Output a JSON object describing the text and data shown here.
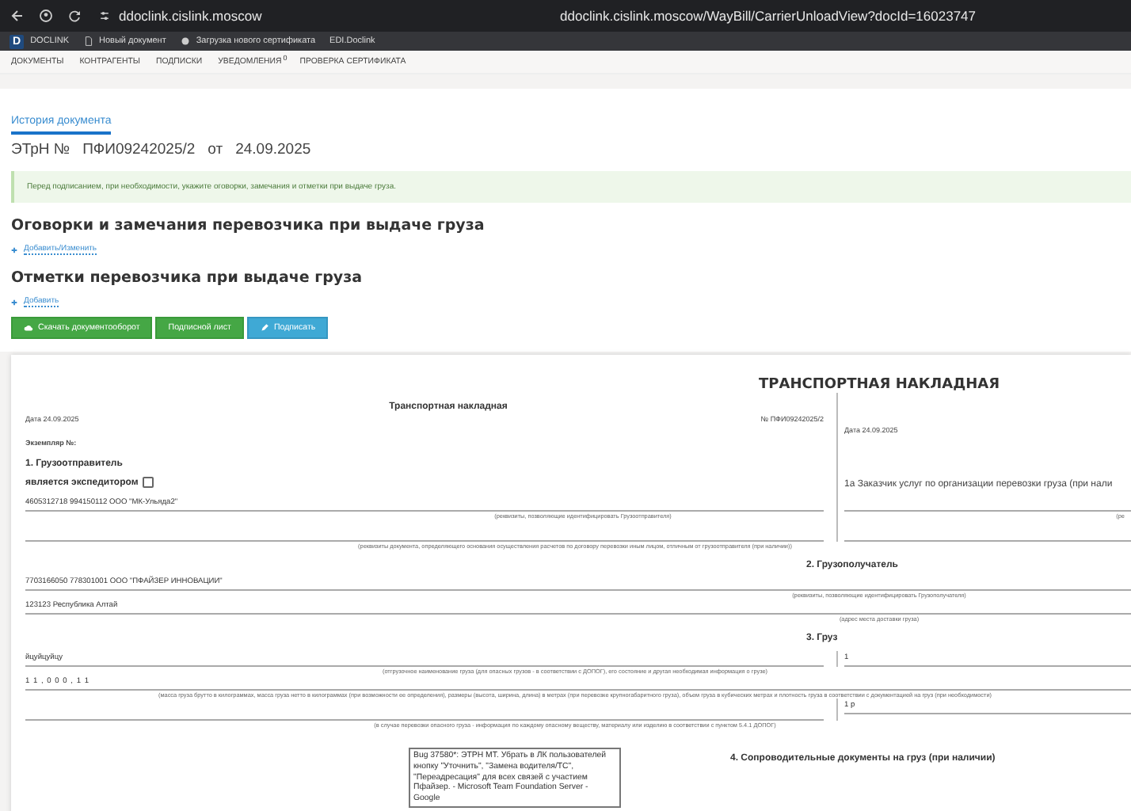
{
  "browser": {
    "address": "ddoclink.cislink.moscow",
    "page_title": "ddoclink.cislink.moscow/WayBill/CarrierUnloadView?docId=16023747"
  },
  "bookmarks": {
    "logo_letter": "D",
    "logo_text": "DOCLINK",
    "items": [
      {
        "kind": "doc",
        "label": "Новый документ"
      },
      {
        "kind": "dot",
        "label": "Загрузка нового сертификата"
      },
      {
        "kind": "plain",
        "label": "EDI.Doclink"
      }
    ]
  },
  "nav": [
    {
      "label": "ДОКУМЕНТЫ"
    },
    {
      "label": "КОНТРАГЕНТЫ"
    },
    {
      "label": "ПОДПИСКИ"
    },
    {
      "label": "УВЕДОМЛЕНИЯ",
      "badge": "0"
    },
    {
      "label": "ПРОВЕРКА СЕРТИФИКАТА"
    }
  ],
  "tabs": [
    {
      "label": "История документа",
      "selected": true
    }
  ],
  "doc_heading": {
    "type": "ЭТрН №",
    "number": "ПФИ09242025/2",
    "from": "от",
    "date": "24.09.2025"
  },
  "alert": "Перед подписанием, при необходимости, укажите оговорки, замечания и отметки при выдаче груза.",
  "sections": [
    {
      "title": "Оговорки и замечания перевозчика при выдаче груза",
      "link": "Добавить/Изменить"
    },
    {
      "title": "Отметки перевозчика при выдаче груза",
      "link": "Добавить"
    }
  ],
  "buttons": [
    {
      "kind": "download",
      "label": "Скачать документооборот"
    },
    {
      "kind": "plain",
      "label": "Подписной лист"
    },
    {
      "kind": "sign",
      "label": "Подписать"
    }
  ],
  "waybill": {
    "title": "ТРАНСПОРТНАЯ НАКЛАДНАЯ",
    "subtitle": "Транспортная накладная",
    "date_left": "Дата 24.09.2025",
    "number": "№  ПФИ09242025/2",
    "date_right": "Дата 24.09.2025",
    "copy": "Экземпляр №:",
    "shipper_title": "1. Грузоотправитель",
    "forwarder_label": "является экспедитором",
    "forwarder_checked": false,
    "shipper_value": "4605312718 994150112 ООО \"МК-Ульяда2\"",
    "shipper_caption": "(реквизиты, позволяющие идентифицировать Грузоотправителя)",
    "payment_caption": "(реквизиты документа, определяющего основания осуществления расчетов по договору перевозки иным лицом, отличным от грузоотправителя (при наличии))",
    "customer_title": "1а Заказчик услуг по организации перевозки груза (при нали",
    "customer_caption": "(ре",
    "consignee_title": "2. Грузополучатель",
    "consignee_value": "7703166050 778301001 ООО \"ПФАЙЗЕР ИННОВАЦИИ\"",
    "consignee_caption": "(реквизиты, позволяющие идентифицировать Грузополучателя)",
    "address_value": "123123 Республика Алтай",
    "address_caption": "(адрес места доставки груза)",
    "cargo_title": "3. Груз",
    "cargo_name": "йцуйцуйцу",
    "cargo_name_caption": "(отгрузочное наименование груза (для опасных грузов - в соответствии с ДОПОГ), его состояние и другая необходимая информация о грузе)",
    "cargo_places": "1",
    "cargo_mass": "1 1 , 0 0 0 , 1 1",
    "cargo_mass_caption": "(масса груза брутто в килограммах, масса груза нетто в килограммах (при возможности ее определения), размеры (высота, ширина, длина) в метрах (при перевозке крупногабаритного груза), объем груза в кубических метрах и плотность груза в соответствии с документацией на груз (при необходимости)",
    "cargo_price": "1 р",
    "danger_caption": "(в случае перевозки опасного груза - информация по каждому опасному веществу, материалу или изделию в соответствии с пунктом 5.4.1 ДОПОГ)",
    "docs_title": "4. Сопроводительные документы на груз (при наличии)"
  },
  "tooltip": "Bug 37580*: ЭТРН МТ. Убрать в ЛК пользователей кнопку \"Уточнить\", \"Замена водителя/ТС\", \"Переадресация\" для всех связей с участием Пфайзер. - Microsoft Team Foundation Server - Google"
}
